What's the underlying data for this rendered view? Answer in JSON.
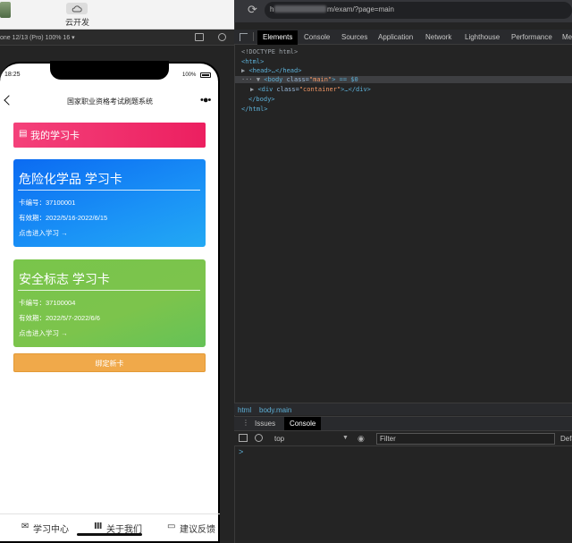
{
  "window": {
    "cloud_label": "云开发",
    "url_prefix": "h",
    "url_text": "m/exam/?page=main",
    "device_label": "one 12/13 (Pro)  100%  16 ▾"
  },
  "devtools": {
    "tabs": [
      "Elements",
      "Console",
      "Sources",
      "Application",
      "Network",
      "Lighthouse",
      "Performance",
      "Me"
    ],
    "active_tab": "Elements",
    "dom": {
      "line1": "<!DOCTYPE html>",
      "line2": "<html>",
      "line3_tag": "<head>",
      "line3_rest": "…</head>",
      "line4_tag": "<body",
      "line4_attr": " class=",
      "line4_val": "\"main\"",
      "line4_rest": "> == $0",
      "line5_tag": "<div",
      "line5_attr": " class=",
      "line5_val": "\"container\"",
      "line5_rest": ">…</div>",
      "line6": "</body>",
      "line7": "</html>"
    },
    "breadcrumbs": [
      "html",
      "body.main"
    ],
    "drawer_tabs": [
      "Issues",
      "Console"
    ],
    "drawer_active": "Console",
    "console_context": "top",
    "filter_placeholder": "Filter",
    "levels_label": "Defa",
    "prompt": ">"
  },
  "phone": {
    "status_time": "18:25",
    "battery_text": "100%",
    "page_title": "国家职业资格考试刷题系统",
    "menu_dots": "•●•",
    "my_card_label": "我的学习卡",
    "cards": [
      {
        "title": "危险化学品 学习卡",
        "card_no": "卡编号：37100001",
        "validity": "有效期：2022/5/16-2022/6/15",
        "enter": "点击进入学习 →"
      },
      {
        "title": "安全标志 学习卡",
        "card_no": "卡编号：37100004",
        "validity": "有效期：2022/5/7-2022/6/6",
        "enter": "点击进入学习 →"
      }
    ],
    "bind_button": "绑定新卡",
    "tabbar": [
      {
        "icon": "book-icon",
        "label": "学习中心"
      },
      {
        "icon": "library-icon",
        "label": "关于我们"
      },
      {
        "icon": "feedback-icon",
        "label": "建议反馈"
      }
    ]
  },
  "colors": {
    "accent_pink": "#ec1f60",
    "card_blue": "#1a92f6",
    "card_green": "#7cc44c",
    "bind_orange": "#f0a94a",
    "devtools_bg": "#242424"
  }
}
